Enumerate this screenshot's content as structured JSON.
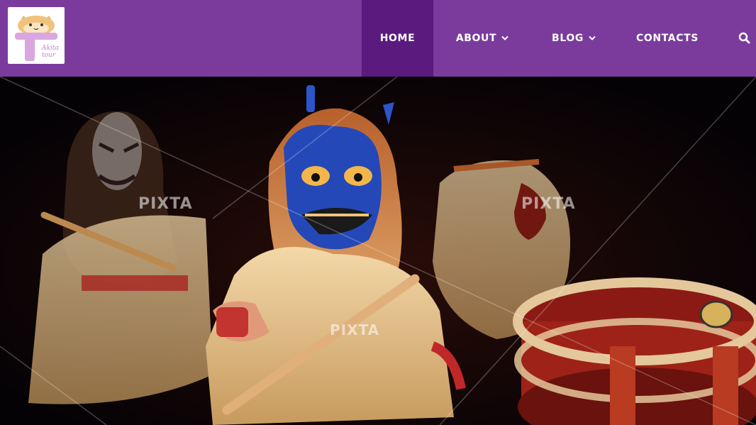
{
  "brand": {
    "logo_line1": "Akita",
    "logo_line2": "tour"
  },
  "nav": {
    "items": [
      {
        "label": "HOME",
        "active": true
      },
      {
        "label": "ABOUT",
        "dropdown": true
      },
      {
        "label": "BLOG",
        "dropdown": true
      },
      {
        "label": "CONTACTS"
      }
    ],
    "search_icon": "search-icon",
    "caret_icon": "chevron-down-icon"
  },
  "hero": {
    "watermark": "PIXTA",
    "description_icon": "namahage-performers-image"
  },
  "colors": {
    "header_bg": "#7b3b9c",
    "active_nav_bg": "#5a1a7e",
    "nav_text": "#ffffff"
  }
}
